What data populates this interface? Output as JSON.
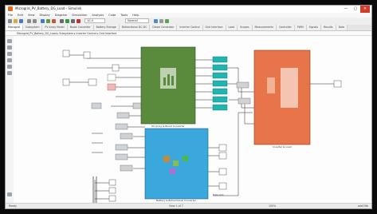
{
  "window": {
    "title": "Microgrid_PV_Battery_DG_Load - Simulink",
    "controls": {
      "minimize": "—",
      "maximize": "▢",
      "close": "✕"
    }
  },
  "menu": [
    "File",
    "Edit",
    "View",
    "Display",
    "Diagram",
    "Simulation",
    "Analysis",
    "Code",
    "Tools",
    "Help"
  ],
  "toolbar": {
    "stop_time": "10.0",
    "mode": "Normal"
  },
  "tabs": [
    {
      "label": "Microgrid"
    },
    {
      "label": "Subsystem"
    },
    {
      "label": "PV Array Model"
    },
    {
      "label": "Boost Converter"
    },
    {
      "label": "Battery Storage"
    },
    {
      "label": "Bidirectional DC-DC"
    },
    {
      "label": "Diesel Generator"
    },
    {
      "label": "Inverter Control"
    },
    {
      "label": "Grid Interface"
    },
    {
      "label": "Load"
    },
    {
      "label": "Scopes"
    },
    {
      "label": "Measurements"
    },
    {
      "label": "Controller"
    },
    {
      "label": "PWM"
    },
    {
      "label": "Signals"
    },
    {
      "label": "Results"
    },
    {
      "label": "Data"
    }
  ],
  "breadcrumb": "Microgrid_PV_Battery_DG_Load ▸ Subsystem ▸ Inverter Control ▸ Grid Interface",
  "canvas": {
    "green_block_label": "PV Array & Boost Converter",
    "blue_block_label": "Battery & Bidirectional Converter",
    "orange_block_label": "Inverter & Load",
    "bottom_label": "Data Out"
  },
  "status": {
    "left": "Ready",
    "mid": "View 1 of 7",
    "zoom": "100%",
    "right": "ode23tb"
  },
  "colors": {
    "green_block": "#5a8a3c",
    "blue_block": "#3aa8dc",
    "orange_block": "#e8744a",
    "teal_port": "#1fb5b0"
  }
}
